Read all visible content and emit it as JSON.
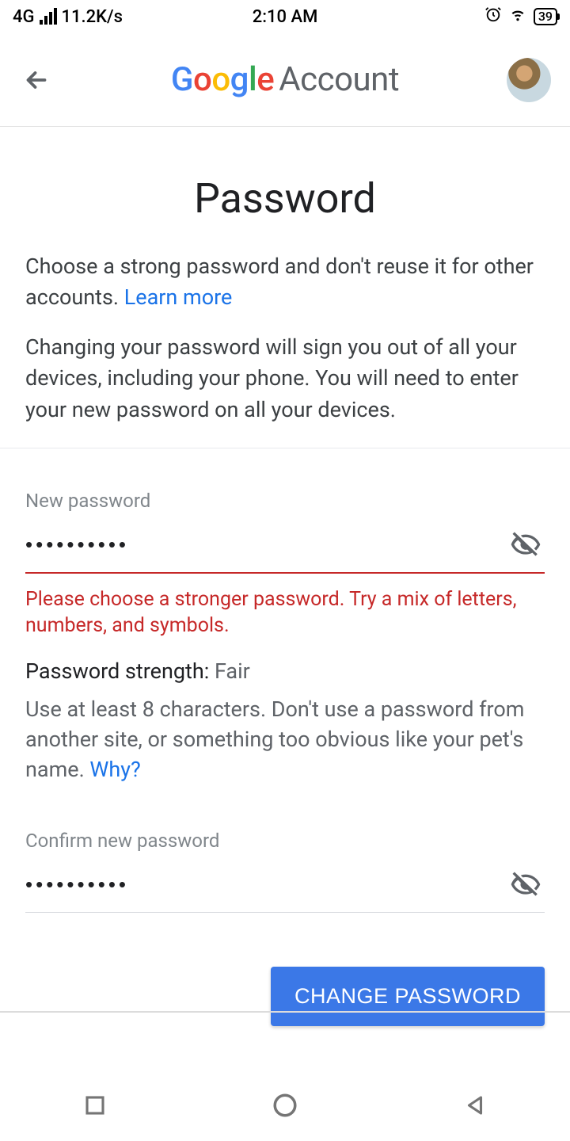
{
  "status": {
    "network": "4G",
    "speed": "11.2K/s",
    "time": "2:10 AM",
    "battery": "39"
  },
  "header": {
    "logo_account": "Account"
  },
  "page": {
    "title": "Password",
    "intro1": "Choose a strong password and don't reuse it for other accounts. ",
    "learn_more": "Learn more",
    "intro2": "Changing your password will sign you out of all your devices, including your phone. You will need to enter your new password on all your devices."
  },
  "form": {
    "new_label": "New password",
    "new_value": "••••••••••",
    "error": "Please choose a stronger password. Try a mix of letters, numbers, and symbols.",
    "strength_label": "Password strength: ",
    "strength_value": "Fair",
    "hint": "Use at least 8 characters. Don't use a password from another site, or something too obvious like your pet's name. ",
    "why": "Why?",
    "confirm_label": "Confirm new password",
    "confirm_value": "••••••••••",
    "submit": "CHANGE PASSWORD"
  }
}
